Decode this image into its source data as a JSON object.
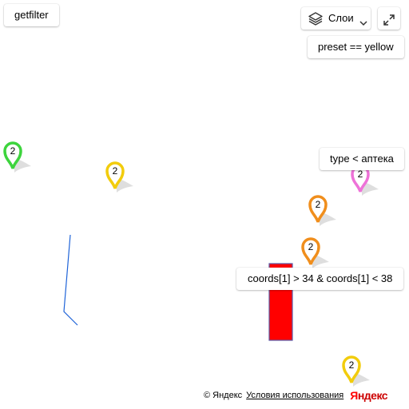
{
  "controls": {
    "getfilter_label": "getfilter",
    "layers_label": "Слои",
    "preset_filter_label": "preset == yellow",
    "type_filter_label": "type < аптека",
    "coords_filter_label": "coords[1] > 34 & coords[1] < 38"
  },
  "icons": {
    "layers": "layers-icon",
    "layers_dropdown": "chevron-down-icon",
    "fullscreen": "expand-icon"
  },
  "clusters": [
    {
      "name": "cluster-green",
      "count": "2",
      "color": "#3dd43d"
    },
    {
      "name": "cluster-yellow-1",
      "count": "2",
      "color": "#f2cc0c"
    },
    {
      "name": "cluster-pink",
      "count": "2",
      "color": "#ee72d8"
    },
    {
      "name": "cluster-orange-1",
      "count": "2",
      "color": "#f08e1c"
    },
    {
      "name": "cluster-orange-2",
      "count": "2",
      "color": "#f08e1c"
    },
    {
      "name": "cluster-yellow-2",
      "count": "2",
      "color": "#f2cc0c"
    }
  ],
  "shapes": {
    "polyline_color": "#1e63d8",
    "rectangle_fill": "#ff0000",
    "rectangle_stroke": "#5a5aa8"
  },
  "copyright": {
    "text": "© Яндекс",
    "terms": "Условия использования",
    "logo_first": "Я",
    "logo_rest": "ндекс"
  }
}
